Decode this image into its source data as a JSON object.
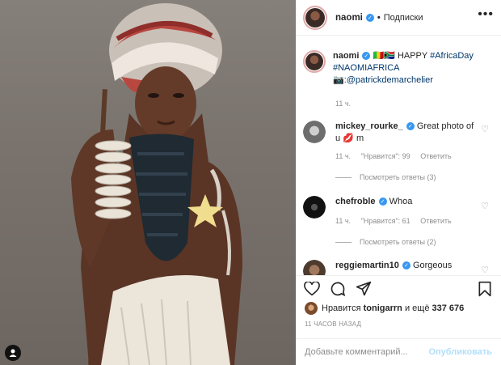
{
  "post_author": {
    "username": "naomi",
    "verified_icon": "verified-icon",
    "separator": "•",
    "follow_label": "Подписки",
    "more_label": "•••"
  },
  "caption": {
    "username": "naomi",
    "emoji": "🇲🇱🇿🇦",
    "text": "HAPPY",
    "hashtag1": "#AfricaDay",
    "hashtag2": "#NAOMIAFRICA",
    "camera_emoji": "📷",
    "credit": ":@patrickdemarchelier",
    "time": "11 ч."
  },
  "comments": [
    {
      "username": "mickey_rourke_",
      "text": "Great photo of u",
      "emoji": "💋",
      "text_end": "m",
      "time": "11 ч.",
      "likes": "\"Нравится\": 99",
      "reply": "Ответить",
      "view_replies": "Посмотреть ответы (3)"
    },
    {
      "username": "chefroble",
      "text": "Whoa",
      "time": "11 ч.",
      "likes": "\"Нравится\": 61",
      "reply": "Ответить",
      "view_replies": "Посмотреть ответы (2)"
    },
    {
      "username": "reggiemartin10",
      "text": "Gorgeous"
    }
  ],
  "likes_summary": {
    "prefix": "Нравится",
    "user": "tonigarrn",
    "suffix": "и ещё",
    "count": "337 676"
  },
  "post_time": "11 ЧАСОВ НАЗАД",
  "comment_box": {
    "placeholder": "Добавьте комментарий...",
    "publish_label": "Опубликовать"
  },
  "colors": {
    "accent": "#3897f0",
    "link": "#00376b",
    "muted": "#8e8e8e",
    "publish_disabled": "#b2dffc"
  }
}
